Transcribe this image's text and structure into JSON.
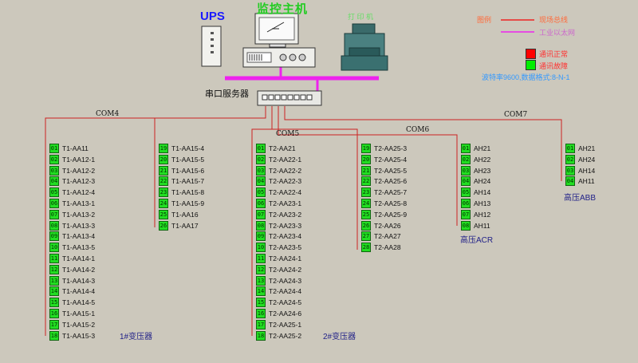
{
  "header": {
    "ups": "UPS",
    "host": "监控主机",
    "printer": "打 印 机",
    "serial_server": "串口服务器"
  },
  "legend": {
    "title": "图例",
    "line_bus": "现场总线",
    "line_ethernet": "工业以太网",
    "status_ok": "通讯正常",
    "status_fault": "通讯故障",
    "colors": {
      "bus": "#ff3030",
      "ethernet": "#ee22ee",
      "ok": "#ff0000",
      "fault": "#00ee00"
    }
  },
  "baud": "波特率9600,数据格式:8-N-1",
  "com": {
    "com4": "COM4",
    "com5": "COM5",
    "com6": "COM6",
    "com7": "COM7"
  },
  "groups": {
    "g1": {
      "label": "1#变压器",
      "col1": [
        {
          "num": "01",
          "name": "T1-AA11"
        },
        {
          "num": "02",
          "name": "T1-AA12-1"
        },
        {
          "num": "03",
          "name": "T1-AA12-2"
        },
        {
          "num": "04",
          "name": "T1-AA12-3"
        },
        {
          "num": "05",
          "name": "T1-AA12-4"
        },
        {
          "num": "06",
          "name": "T1-AA13-1"
        },
        {
          "num": "07",
          "name": "T1-AA13-2"
        },
        {
          "num": "08",
          "name": "T1-AA13-3"
        },
        {
          "num": "09",
          "name": "T1-AA13-4"
        },
        {
          "num": "10",
          "name": "T1-AA13-5"
        },
        {
          "num": "11",
          "name": "T1-AA14-1"
        },
        {
          "num": "12",
          "name": "T1-AA14-2"
        },
        {
          "num": "13",
          "name": "T1-AA14-3"
        },
        {
          "num": "14",
          "name": "T1-AA14-4"
        },
        {
          "num": "15",
          "name": "T1-AA14-5"
        },
        {
          "num": "16",
          "name": "T1-AA15-1"
        },
        {
          "num": "17",
          "name": "T1-AA15-2"
        },
        {
          "num": "18",
          "name": "T1-AA15-3"
        }
      ],
      "col2": [
        {
          "num": "19",
          "name": "T1-AA15-4"
        },
        {
          "num": "20",
          "name": "T1-AA15-5"
        },
        {
          "num": "21",
          "name": "T1-AA15-6"
        },
        {
          "num": "22",
          "name": "T1-AA15-7"
        },
        {
          "num": "23",
          "name": "T1-AA15-8"
        },
        {
          "num": "24",
          "name": "T1-AA15-9"
        },
        {
          "num": "25",
          "name": "T1-AA16"
        },
        {
          "num": "26",
          "name": "T1-AA17"
        }
      ]
    },
    "g2": {
      "label": "2#变压器",
      "col1": [
        {
          "num": "01",
          "name": "T2-AA21"
        },
        {
          "num": "02",
          "name": "T2-AA22-1"
        },
        {
          "num": "03",
          "name": "T2-AA22-2"
        },
        {
          "num": "04",
          "name": "T2-AA22-3"
        },
        {
          "num": "05",
          "name": "T2-AA22-4"
        },
        {
          "num": "06",
          "name": "T2-AA23-1"
        },
        {
          "num": "07",
          "name": "T2-AA23-2"
        },
        {
          "num": "08",
          "name": "T2-AA23-3"
        },
        {
          "num": "09",
          "name": "T2-AA23-4"
        },
        {
          "num": "10",
          "name": "T2-AA23-5"
        },
        {
          "num": "11",
          "name": "T2-AA24-1"
        },
        {
          "num": "12",
          "name": "T2-AA24-2"
        },
        {
          "num": "13",
          "name": "T2-AA24-3"
        },
        {
          "num": "14",
          "name": "T2-AA24-4"
        },
        {
          "num": "15",
          "name": "T2-AA24-5"
        },
        {
          "num": "16",
          "name": "T2-AA24-6"
        },
        {
          "num": "17",
          "name": "T2-AA25-1"
        },
        {
          "num": "18",
          "name": "T2-AA25-2"
        }
      ],
      "col2": [
        {
          "num": "19",
          "name": "T2-AA25-3"
        },
        {
          "num": "20",
          "name": "T2-AA25-4"
        },
        {
          "num": "21",
          "name": "T2-AA25-5"
        },
        {
          "num": "22",
          "name": "T2-AA25-6"
        },
        {
          "num": "23",
          "name": "T2-AA25-7"
        },
        {
          "num": "24",
          "name": "T2-AA25-8"
        },
        {
          "num": "25",
          "name": "T2-AA25-9"
        },
        {
          "num": "26",
          "name": "T2-AA26"
        },
        {
          "num": "27",
          "name": "T2-AA27"
        },
        {
          "num": "28",
          "name": "T2-AA28"
        }
      ]
    },
    "acr": {
      "label": "高压ACR",
      "col1": [
        {
          "num": "01",
          "name": "AH21"
        },
        {
          "num": "02",
          "name": "AH22"
        },
        {
          "num": "03",
          "name": "AH23"
        },
        {
          "num": "04",
          "name": "AH24"
        },
        {
          "num": "05",
          "name": "AH14"
        },
        {
          "num": "06",
          "name": "AH13"
        },
        {
          "num": "07",
          "name": "AH12"
        },
        {
          "num": "08",
          "name": "AH11"
        }
      ]
    },
    "abb": {
      "label": "高压ABB",
      "col1": [
        {
          "num": "01",
          "name": "AH21"
        },
        {
          "num": "02",
          "name": "AH24"
        },
        {
          "num": "03",
          "name": "AH14"
        },
        {
          "num": "04",
          "name": "AH11"
        }
      ]
    }
  }
}
